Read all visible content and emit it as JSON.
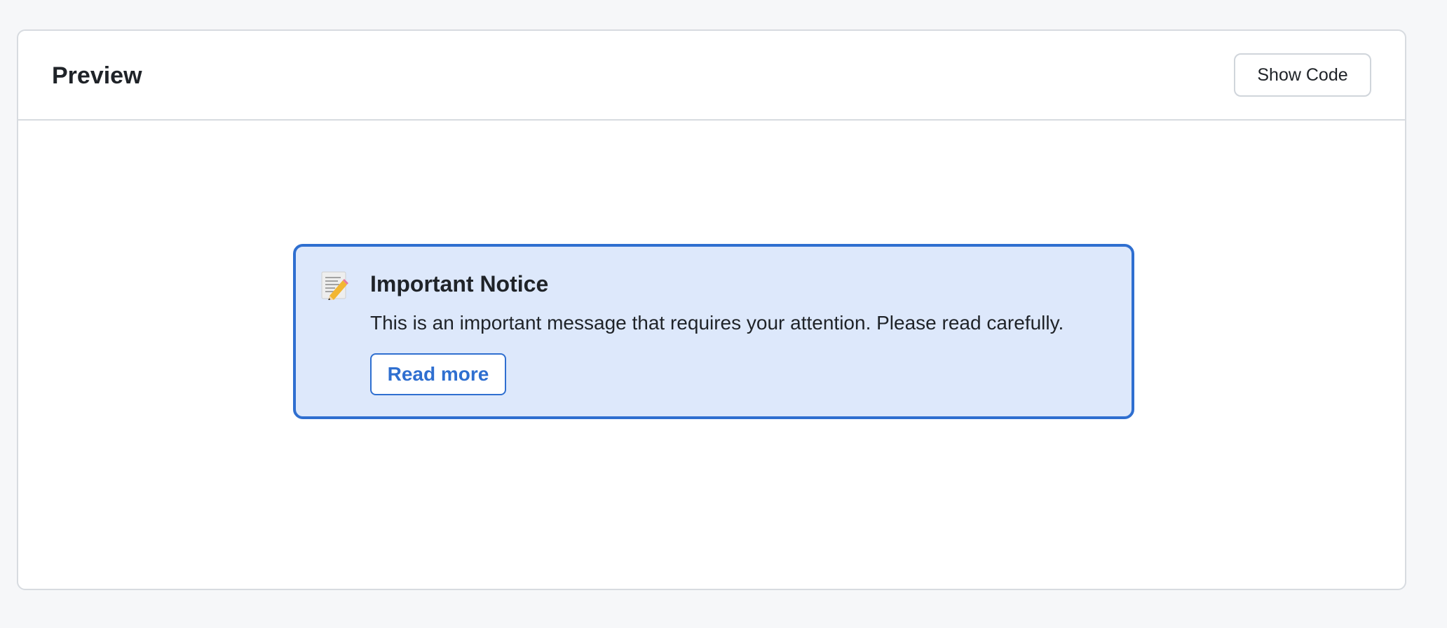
{
  "panel": {
    "title": "Preview",
    "show_code_label": "Show Code"
  },
  "notice": {
    "icon": "memo-pencil-icon",
    "title": "Important Notice",
    "message": "This is an important message that requires your attention. Please read carefully.",
    "read_more_label": "Read more",
    "colors": {
      "accent": "#2f6fd0",
      "background": "#dde8fb"
    }
  }
}
